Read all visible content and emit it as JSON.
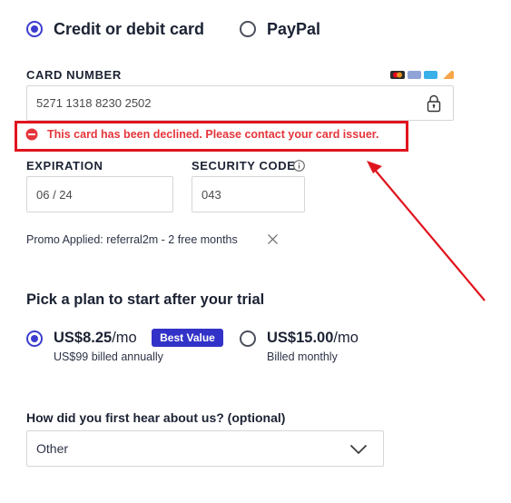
{
  "payment_methods": {
    "card_label": "Credit or debit card",
    "paypal_label": "PayPal",
    "selected": "card"
  },
  "card_number": {
    "label": "CARD NUMBER",
    "value": "5271 1318 8230 2502",
    "card_logos": [
      "mastercard-logo",
      "amex-logo",
      "visa-logo",
      "discover-logo"
    ]
  },
  "error": {
    "message": "This card has been declined. Please contact your card issuer."
  },
  "expiration": {
    "label": "EXPIRATION",
    "value": "06 / 24"
  },
  "security_code": {
    "label": "SECURITY CODE",
    "value": "043"
  },
  "promo": {
    "text": "Promo Applied: referral2m - 2 free months"
  },
  "plan": {
    "title": "Pick a plan to start after your trial",
    "options": [
      {
        "price": "US$8.25",
        "unit": "/mo",
        "badge": "Best Value",
        "billing": "US$99 billed annually",
        "selected": true
      },
      {
        "price": "US$15.00",
        "unit": "/mo",
        "billing": "Billed monthly",
        "selected": false
      }
    ]
  },
  "survey": {
    "question": "How did you first hear about us? (optional)",
    "selected": "Other"
  },
  "colors": {
    "accent": "#3c3ccf",
    "badge": "#3232c8",
    "error": "#e5353b",
    "annotation": "#e0141e"
  }
}
